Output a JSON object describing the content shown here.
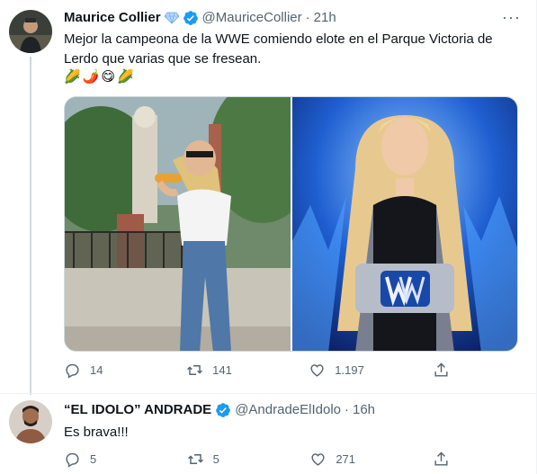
{
  "tweet1": {
    "name": "Maurice Collier",
    "handle": "@MauriceCollier",
    "dot": "·",
    "time": "21h",
    "text": "Mejor la campeona de la WWE comiendo elote en el Parque Victoria de Lerdo que varias que se fresean.",
    "emojis": [
      "🌽",
      "🌶️",
      "😋",
      "🌽"
    ],
    "more": "···",
    "stats": {
      "replies": "14",
      "retweets": "141",
      "likes": "1.197"
    },
    "badge_color": "#b7d7ff"
  },
  "tweet2": {
    "name": "“EL IDOLO” ANDRADE",
    "handle": "@AndradeElIdolo",
    "dot": "·",
    "time": "16h",
    "text": "Es brava!!!",
    "stats": {
      "replies": "5",
      "retweets": "5",
      "likes": "271"
    },
    "badge_color": "#1d9bf0"
  },
  "icons": [
    "reply-icon",
    "retweet-icon",
    "like-icon",
    "share-icon",
    "more-icon",
    "verified-icon",
    "diamond-icon"
  ],
  "colors": {
    "text": "#0f1419",
    "muted": "#536471",
    "border": "#eff3f4",
    "accent": "#1d9bf0"
  }
}
